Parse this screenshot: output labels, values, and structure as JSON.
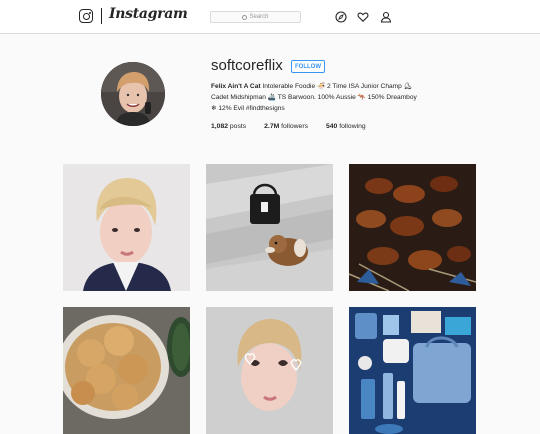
{
  "header": {
    "wordmark": "Instagram",
    "search_placeholder": "Search",
    "icons": [
      "instagram-logo-icon",
      "compass-icon",
      "heart-icon",
      "person-icon"
    ]
  },
  "profile": {
    "username": "softcoreflix",
    "follow_label": "FOLLOW",
    "bio_name": "Felix Ain't A Cat",
    "bio_line1": " Intolerable Foodie 🍜 2 Time ISA Junior Champ ⛸",
    "bio_line2": "Cadet Midshipman 🚢 TS Barwoon. 100% Aussie 🦘 150% Dreamboy",
    "bio_line3": "❄ 12% Evil #findthesigns",
    "posts_count": "1,082",
    "posts_label": " posts",
    "followers_count": "2.7M",
    "followers_label": " followers",
    "following_count": "540",
    "following_label": " following"
  },
  "posts": [
    {
      "subject": "selfie-boy-blonde"
    },
    {
      "subject": "bag-and-plush-on-blanket"
    },
    {
      "subject": "grilled-skewers"
    },
    {
      "subject": "pastries-in-bowl"
    },
    {
      "subject": "selfie-with-hearts"
    },
    {
      "subject": "blue-flatlay"
    }
  ],
  "colors": {
    "accent": "#3897f0",
    "border": "#dbdbdb",
    "background": "#fafafa"
  }
}
